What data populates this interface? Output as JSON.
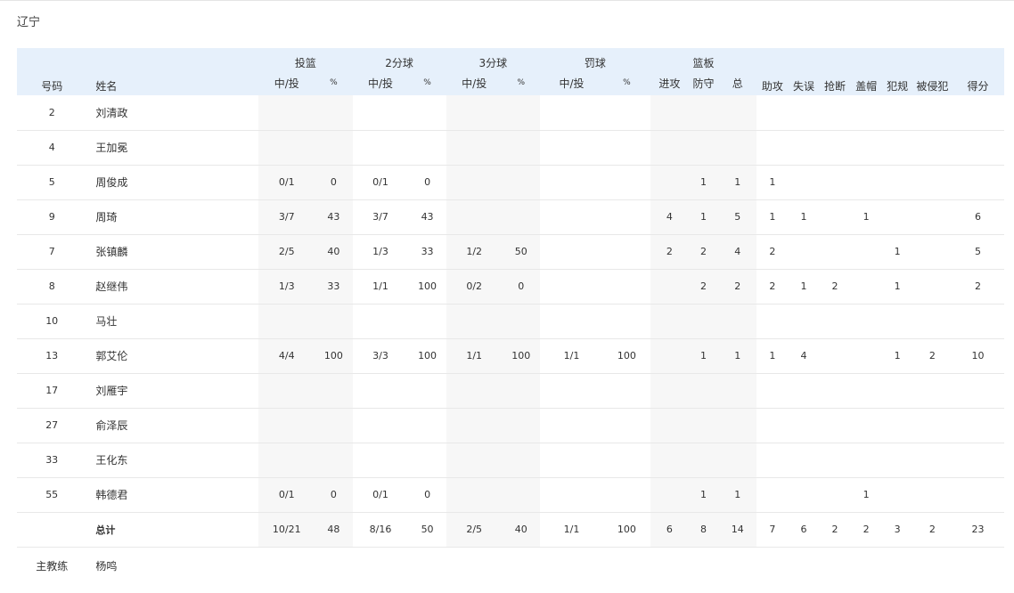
{
  "team_name": "辽宁",
  "headers": {
    "number": "号码",
    "name": "姓名",
    "fg_group": "投篮",
    "two_group": "2分球",
    "three_group": "3分球",
    "ft_group": "罚球",
    "reb_group": "篮板",
    "made_att": "中/投",
    "pct": "%",
    "off_reb": "进攻",
    "def_reb": "防守",
    "tot_reb": "总",
    "assists": "助攻",
    "turnovers": "失误",
    "steals": "抢断",
    "blocks": "盖帽",
    "fouls": "犯规",
    "fouled": "被侵犯",
    "points": "得分"
  },
  "players": [
    {
      "num": "2",
      "name": "刘清政",
      "fg": "",
      "fgp": "",
      "two": "",
      "twop": "",
      "three": "",
      "threep": "",
      "ft": "",
      "ftp": "",
      "oreb": "",
      "dreb": "",
      "treb": "",
      "ast": "",
      "tov": "",
      "stl": "",
      "blk": "",
      "pf": "",
      "fd": "",
      "pts": ""
    },
    {
      "num": "4",
      "name": "王加冕",
      "fg": "",
      "fgp": "",
      "two": "",
      "twop": "",
      "three": "",
      "threep": "",
      "ft": "",
      "ftp": "",
      "oreb": "",
      "dreb": "",
      "treb": "",
      "ast": "",
      "tov": "",
      "stl": "",
      "blk": "",
      "pf": "",
      "fd": "",
      "pts": ""
    },
    {
      "num": "5",
      "name": "周俊成",
      "fg": "0/1",
      "fgp": "0",
      "two": "0/1",
      "twop": "0",
      "three": "",
      "threep": "",
      "ft": "",
      "ftp": "",
      "oreb": "",
      "dreb": "1",
      "treb": "1",
      "ast": "1",
      "tov": "",
      "stl": "",
      "blk": "",
      "pf": "",
      "fd": "",
      "pts": ""
    },
    {
      "num": "9",
      "name": "周琦",
      "fg": "3/7",
      "fgp": "43",
      "two": "3/7",
      "twop": "43",
      "three": "",
      "threep": "",
      "ft": "",
      "ftp": "",
      "oreb": "4",
      "dreb": "1",
      "treb": "5",
      "ast": "1",
      "tov": "1",
      "stl": "",
      "blk": "1",
      "pf": "",
      "fd": "",
      "pts": "6"
    },
    {
      "num": "7",
      "name": "张镇麟",
      "fg": "2/5",
      "fgp": "40",
      "two": "1/3",
      "twop": "33",
      "three": "1/2",
      "threep": "50",
      "ft": "",
      "ftp": "",
      "oreb": "2",
      "dreb": "2",
      "treb": "4",
      "ast": "2",
      "tov": "",
      "stl": "",
      "blk": "",
      "pf": "1",
      "fd": "",
      "pts": "5"
    },
    {
      "num": "8",
      "name": "赵继伟",
      "fg": "1/3",
      "fgp": "33",
      "two": "1/1",
      "twop": "100",
      "three": "0/2",
      "threep": "0",
      "ft": "",
      "ftp": "",
      "oreb": "",
      "dreb": "2",
      "treb": "2",
      "ast": "2",
      "tov": "1",
      "stl": "2",
      "blk": "",
      "pf": "1",
      "fd": "",
      "pts": "2"
    },
    {
      "num": "10",
      "name": "马壮",
      "fg": "",
      "fgp": "",
      "two": "",
      "twop": "",
      "three": "",
      "threep": "",
      "ft": "",
      "ftp": "",
      "oreb": "",
      "dreb": "",
      "treb": "",
      "ast": "",
      "tov": "",
      "stl": "",
      "blk": "",
      "pf": "",
      "fd": "",
      "pts": ""
    },
    {
      "num": "13",
      "name": "郭艾伦",
      "fg": "4/4",
      "fgp": "100",
      "two": "3/3",
      "twop": "100",
      "three": "1/1",
      "threep": "100",
      "ft": "1/1",
      "ftp": "100",
      "oreb": "",
      "dreb": "1",
      "treb": "1",
      "ast": "1",
      "tov": "4",
      "stl": "",
      "blk": "",
      "pf": "1",
      "fd": "2",
      "pts": "10"
    },
    {
      "num": "17",
      "name": "刘雁宇",
      "fg": "",
      "fgp": "",
      "two": "",
      "twop": "",
      "three": "",
      "threep": "",
      "ft": "",
      "ftp": "",
      "oreb": "",
      "dreb": "",
      "treb": "",
      "ast": "",
      "tov": "",
      "stl": "",
      "blk": "",
      "pf": "",
      "fd": "",
      "pts": ""
    },
    {
      "num": "27",
      "name": "俞泽辰",
      "fg": "",
      "fgp": "",
      "two": "",
      "twop": "",
      "three": "",
      "threep": "",
      "ft": "",
      "ftp": "",
      "oreb": "",
      "dreb": "",
      "treb": "",
      "ast": "",
      "tov": "",
      "stl": "",
      "blk": "",
      "pf": "",
      "fd": "",
      "pts": ""
    },
    {
      "num": "33",
      "name": "王化东",
      "fg": "",
      "fgp": "",
      "two": "",
      "twop": "",
      "three": "",
      "threep": "",
      "ft": "",
      "ftp": "",
      "oreb": "",
      "dreb": "",
      "treb": "",
      "ast": "",
      "tov": "",
      "stl": "",
      "blk": "",
      "pf": "",
      "fd": "",
      "pts": ""
    },
    {
      "num": "55",
      "name": "韩德君",
      "fg": "0/1",
      "fgp": "0",
      "two": "0/1",
      "twop": "0",
      "three": "",
      "threep": "",
      "ft": "",
      "ftp": "",
      "oreb": "",
      "dreb": "1",
      "treb": "1",
      "ast": "",
      "tov": "",
      "stl": "",
      "blk": "1",
      "pf": "",
      "fd": "",
      "pts": ""
    }
  ],
  "total": {
    "num": "",
    "name": "总计",
    "fg": "10/21",
    "fgp": "48",
    "two": "8/16",
    "twop": "50",
    "three": "2/5",
    "threep": "40",
    "ft": "1/1",
    "ftp": "100",
    "oreb": "6",
    "dreb": "8",
    "treb": "14",
    "ast": "7",
    "tov": "6",
    "stl": "2",
    "blk": "2",
    "pf": "3",
    "fd": "2",
    "pts": "23"
  },
  "coach": {
    "label": "主教练",
    "name": "杨鸣"
  }
}
